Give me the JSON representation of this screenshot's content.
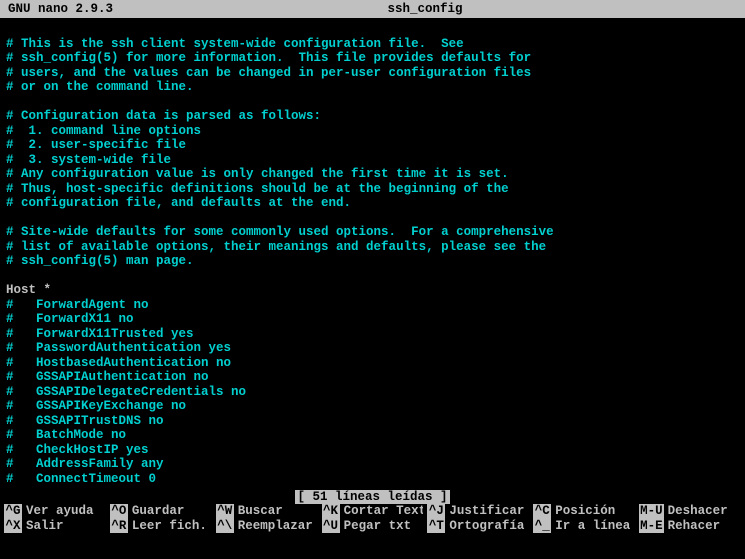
{
  "titlebar": {
    "app": "GNU nano 2.9.3",
    "filename": "ssh_config"
  },
  "content_lines": [
    "",
    "# This is the ssh client system-wide configuration file.  See",
    "# ssh_config(5) for more information.  This file provides defaults for",
    "# users, and the values can be changed in per-user configuration files",
    "# or on the command line.",
    "",
    "# Configuration data is parsed as follows:",
    "#  1. command line options",
    "#  2. user-specific file",
    "#  3. system-wide file",
    "# Any configuration value is only changed the first time it is set.",
    "# Thus, host-specific definitions should be at the beginning of the",
    "# configuration file, and defaults at the end.",
    "",
    "# Site-wide defaults for some commonly used options.  For a comprehensive",
    "# list of available options, their meanings and defaults, please see the",
    "# ssh_config(5) man page.",
    ""
  ],
  "host_line": "Host *",
  "host_options": [
    "#   ForwardAgent no",
    "#   ForwardX11 no",
    "#   ForwardX11Trusted yes",
    "#   PasswordAuthentication yes",
    "#   HostbasedAuthentication no",
    "#   GSSAPIAuthentication no",
    "#   GSSAPIDelegateCredentials no",
    "#   GSSAPIKeyExchange no",
    "#   GSSAPITrustDNS no",
    "#   BatchMode no",
    "#   CheckHostIP yes",
    "#   AddressFamily any",
    "#   ConnectTimeout 0"
  ],
  "status": "[ 51 líneas leídas ]",
  "shortcuts": [
    {
      "key": "^G",
      "label": "Ver ayuda"
    },
    {
      "key": "^O",
      "label": "Guardar"
    },
    {
      "key": "^W",
      "label": "Buscar"
    },
    {
      "key": "^K",
      "label": "Cortar Text"
    },
    {
      "key": "^J",
      "label": "Justificar"
    },
    {
      "key": "^C",
      "label": "Posición"
    },
    {
      "key": "M-U",
      "label": "Deshacer"
    },
    {
      "key": "^X",
      "label": "Salir"
    },
    {
      "key": "^R",
      "label": "Leer fich."
    },
    {
      "key": "^\\",
      "label": "Reemplazar"
    },
    {
      "key": "^U",
      "label": "Pegar txt"
    },
    {
      "key": "^T",
      "label": "Ortografía"
    },
    {
      "key": "^_",
      "label": "Ir a línea"
    },
    {
      "key": "M-E",
      "label": "Rehacer"
    }
  ]
}
